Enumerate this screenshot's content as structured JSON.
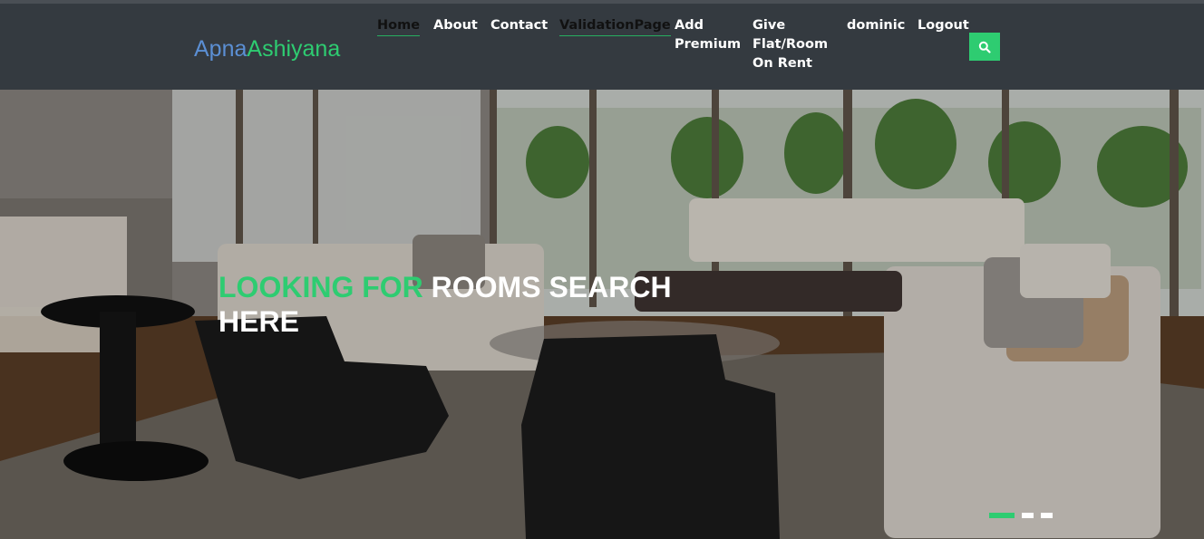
{
  "brand": {
    "part1": "Apna",
    "part2": "Ashiyana"
  },
  "nav": {
    "home": "Home",
    "about": "About",
    "contact": "Contact",
    "validation": "ValidationPage",
    "add_premium": [
      "Add",
      "Premium"
    ],
    "give_flat": [
      "Give",
      "Flat/Room",
      "On Rent"
    ],
    "user": "dominic",
    "logout": "Logout"
  },
  "search": {
    "icon": "search-icon"
  },
  "hero": {
    "headline_green": "LOOKING FOR",
    "headline_white": "ROOMS SEARCH HERE"
  },
  "carousel": {
    "slide_count": 3,
    "active_index": 0
  },
  "colors": {
    "accent": "#2ecc71",
    "navbar": "#343a40",
    "brand_blue": "#5b8fd4"
  }
}
